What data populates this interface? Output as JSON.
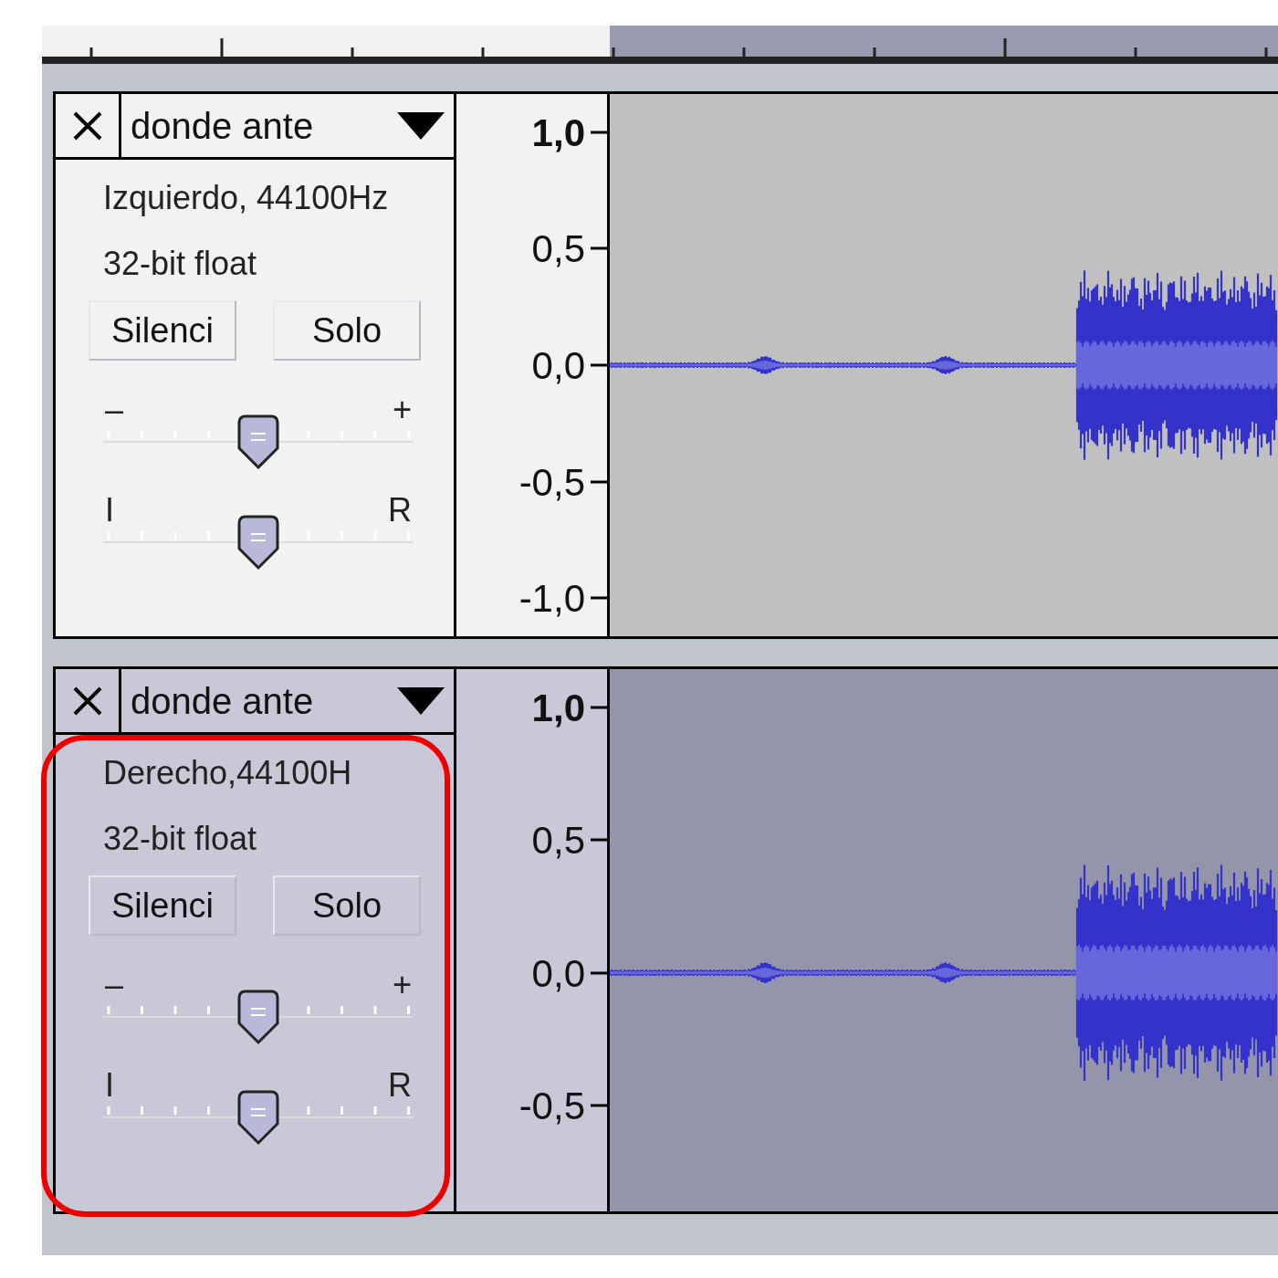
{
  "tracks": [
    {
      "name": "donde ante",
      "selected": false,
      "highlighted": false,
      "info": [
        "Izquierdo, 44100Hz",
        "32-bit float"
      ],
      "buttons": [
        "Silenci",
        "Solo"
      ],
      "gain": {
        "min_label": "–",
        "max_label": "+",
        "level": 0.5
      },
      "pan": {
        "min_label": "I",
        "max_label": "R",
        "level": 0.5
      },
      "scale": [
        "1,0",
        "0,5",
        "0,0",
        "-0,5",
        "-1,0"
      ]
    },
    {
      "name": "donde ante",
      "selected": true,
      "highlighted": true,
      "info": [
        "Derecho,44100H",
        "32-bit float"
      ],
      "buttons": [
        "Silenci",
        "Solo"
      ],
      "gain": {
        "min_label": "–",
        "max_label": "+",
        "level": 0.5
      },
      "pan": {
        "min_label": "I",
        "max_label": "R",
        "level": 0.5
      },
      "scale": [
        "1,0",
        "0,5",
        "0,0",
        "-0,5"
      ]
    }
  ]
}
